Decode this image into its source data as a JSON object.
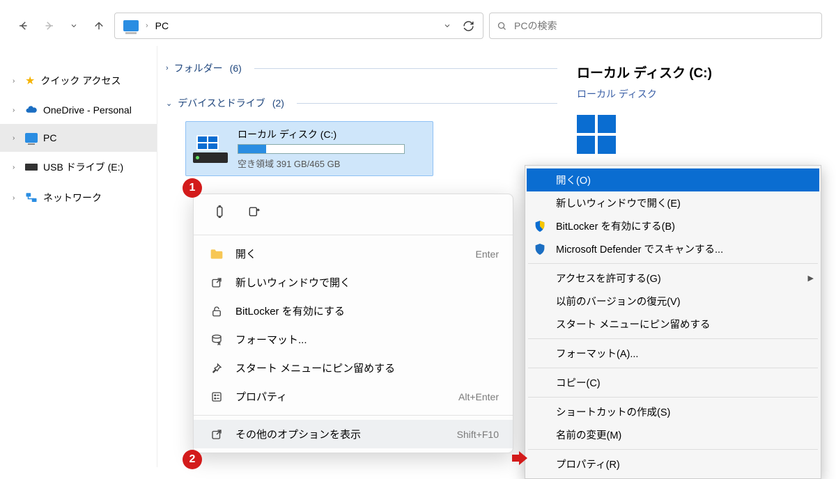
{
  "topbar": {
    "breadcrumb_label": "PC",
    "search_placeholder": "PCの検索"
  },
  "sidebar": {
    "items": [
      {
        "label": "クイック アクセス",
        "icon": "star"
      },
      {
        "label": "OneDrive - Personal",
        "icon": "cloud"
      },
      {
        "label": "PC",
        "icon": "pc",
        "selected": true
      },
      {
        "label": "USB ドライブ (E:)",
        "icon": "usb"
      },
      {
        "label": "ネットワーク",
        "icon": "net"
      }
    ]
  },
  "center": {
    "group1": {
      "label": "フォルダー",
      "count": "(6)"
    },
    "group2": {
      "label": "デバイスとドライブ",
      "count": "(2)"
    },
    "drive": {
      "name": "ローカル ディスク (C:)",
      "free": "空き領域 391 GB/465 GB"
    }
  },
  "details": {
    "title": "ローカル ディスク (C:)",
    "subtitle": "ローカル ディスク"
  },
  "ctx1": {
    "items": [
      {
        "icon": "folder",
        "label": "開く",
        "shortcut": "Enter"
      },
      {
        "icon": "open-ext",
        "label": "新しいウィンドウで開く",
        "shortcut": ""
      },
      {
        "icon": "lock",
        "label": "BitLocker を有効にする",
        "shortcut": ""
      },
      {
        "icon": "format",
        "label": "フォーマット...",
        "shortcut": ""
      },
      {
        "icon": "pin",
        "label": "スタート メニューにピン留めする",
        "shortcut": ""
      },
      {
        "icon": "prop",
        "label": "プロパティ",
        "shortcut": "Alt+Enter"
      },
      {
        "icon": "more",
        "label": "その他のオプションを表示",
        "shortcut": "Shift+F10",
        "selected": true
      }
    ]
  },
  "ctx2": {
    "items": [
      {
        "label": "開く(O)",
        "hl": true
      },
      {
        "label": "新しいウィンドウで開く(E)"
      },
      {
        "icon": "shield-y",
        "label": "BitLocker を有効にする(B)"
      },
      {
        "icon": "shield-b",
        "label": "Microsoft Defender でスキャンする..."
      },
      {
        "divider": true
      },
      {
        "label": "アクセスを許可する(G)",
        "arrow": true
      },
      {
        "label": "以前のバージョンの復元(V)"
      },
      {
        "label": "スタート メニューにピン留めする"
      },
      {
        "divider": true
      },
      {
        "label": "フォーマット(A)..."
      },
      {
        "divider": true
      },
      {
        "label": "コピー(C)"
      },
      {
        "divider": true
      },
      {
        "label": "ショートカットの作成(S)"
      },
      {
        "label": "名前の変更(M)"
      },
      {
        "divider": true
      },
      {
        "label": "プロパティ(R)"
      }
    ]
  },
  "badges": {
    "b1": "1",
    "b2": "2"
  }
}
